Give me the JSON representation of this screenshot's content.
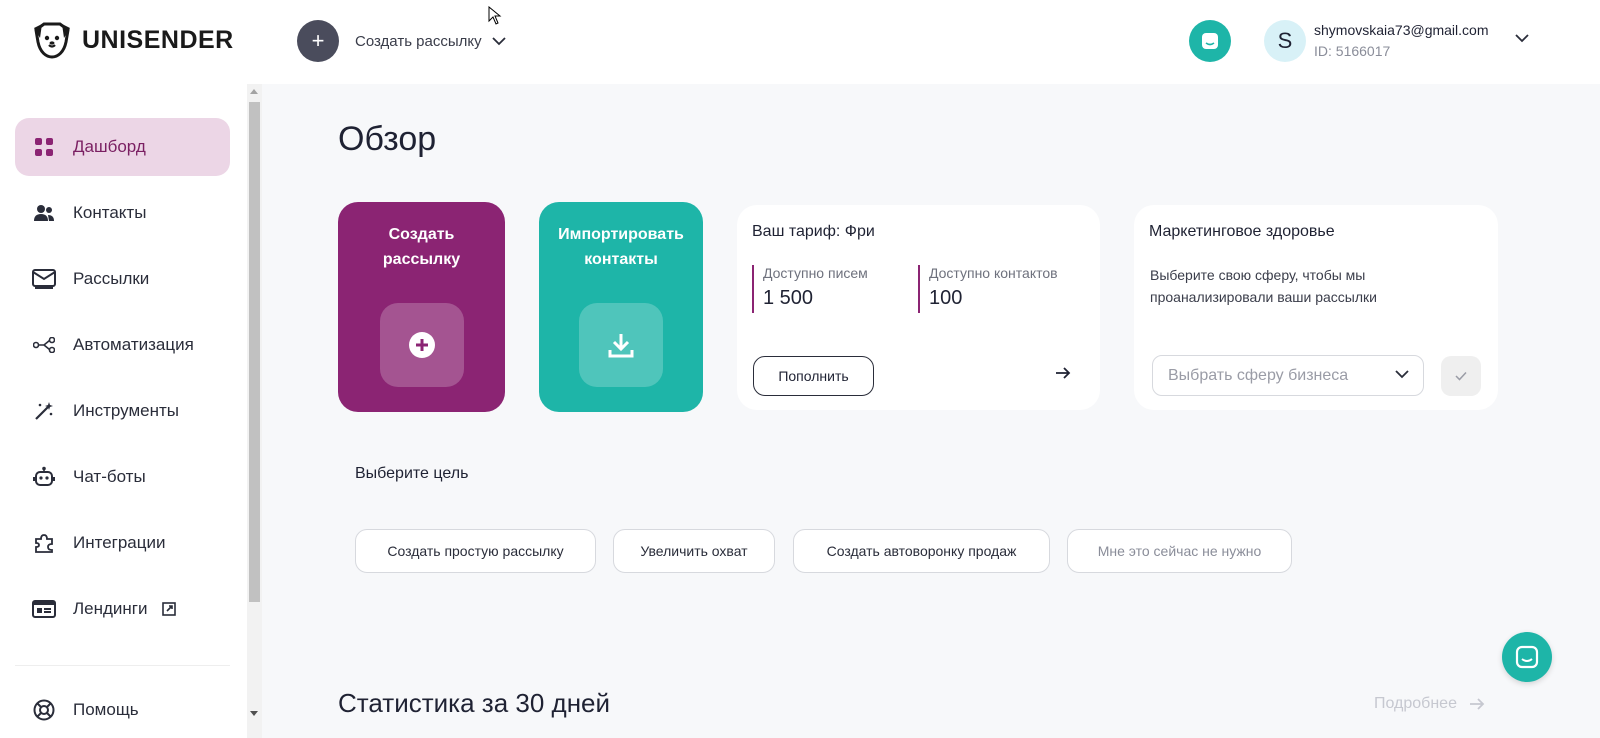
{
  "header": {
    "logo_text": "UNISENDER",
    "create_label": "Создать рассылку",
    "user_initial": "S",
    "user_email": "shymovskaia73@gmail.com",
    "user_id": "ID: 5166017"
  },
  "sidebar": {
    "items": [
      {
        "label": "Дашборд",
        "icon": "dashboard-icon"
      },
      {
        "label": "Контакты",
        "icon": "contacts-icon"
      },
      {
        "label": "Рассылки",
        "icon": "mail-icon"
      },
      {
        "label": "Автоматизация",
        "icon": "automation-icon"
      },
      {
        "label": "Инструменты",
        "icon": "magic-wand-icon"
      },
      {
        "label": "Чат-боты",
        "icon": "robot-icon"
      },
      {
        "label": "Интеграции",
        "icon": "puzzle-icon"
      },
      {
        "label": "Лендинги",
        "icon": "landing-icon"
      },
      {
        "label": "Помощь",
        "icon": "help-icon"
      }
    ]
  },
  "main": {
    "title": "Обзор",
    "create_card": {
      "title": "Создать рассылку"
    },
    "import_card": {
      "title": "Импортировать контакты"
    },
    "tariff": {
      "title": "Ваш тариф: Фри",
      "emails_label": "Доступно писем",
      "emails_value": "1 500",
      "contacts_label": "Доступно контактов",
      "contacts_value": "100",
      "topup_label": "Пополнить"
    },
    "health": {
      "title": "Маркетинговое здоровье",
      "description": "Выберите свою сферу, чтобы мы проанализировали ваши рассылки",
      "select_placeholder": "Выбрать сферу бизнеса"
    },
    "goals": {
      "title": "Выберите цель",
      "buttons": [
        "Создать простую рассылку",
        "Увеличить охват",
        "Создать автоворонку продаж",
        "Мне это сейчас не нужно"
      ]
    },
    "stats": {
      "title": "Статистика за 30 дней",
      "more_label": "Подробнее"
    }
  },
  "colors": {
    "accent_purple": "#8b2473",
    "accent_teal": "#1eb5a8",
    "active_bg": "#ecd6e6"
  }
}
